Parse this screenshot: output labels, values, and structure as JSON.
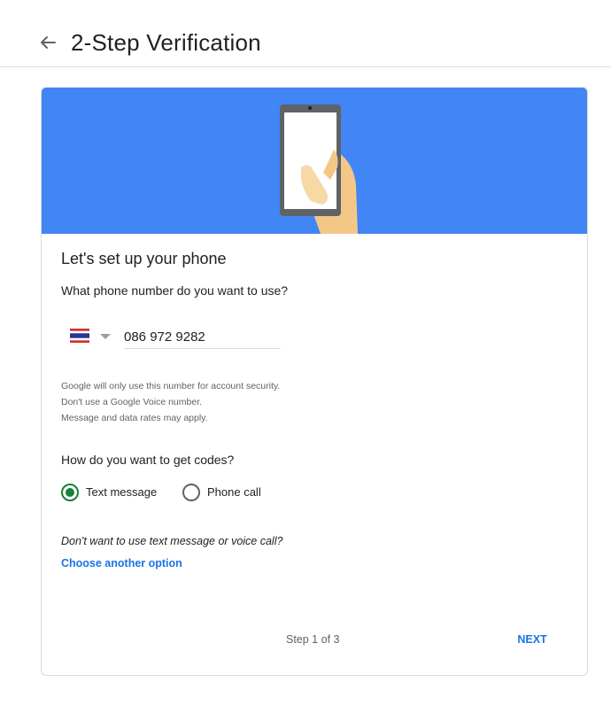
{
  "header": {
    "back_icon": "arrow-left-icon",
    "title": "2-Step Verification"
  },
  "banner": {
    "illustration": "hand-holding-phone-illustration",
    "color": "#4285f4"
  },
  "form": {
    "setup_title": "Let's set up your phone",
    "phone_question": "What phone number do you want to use?",
    "country_flag": "thailand-flag-icon",
    "phone_value": "086 972 9282",
    "notes": [
      "Google will only use this number for account security.",
      "Don't use a Google Voice number.",
      "Message and data rates may apply."
    ],
    "codes_question": "How do you want to get codes?",
    "options": [
      {
        "label": "Text message",
        "checked": true
      },
      {
        "label": "Phone call",
        "checked": false
      }
    ],
    "alt_question": "Don't want to use text message or voice call?",
    "alt_link": "Choose another option"
  },
  "footer": {
    "step": "Step 1 of 3",
    "next": "NEXT"
  },
  "colors": {
    "accent": "#1a73e8",
    "radio_checked": "#188038"
  }
}
